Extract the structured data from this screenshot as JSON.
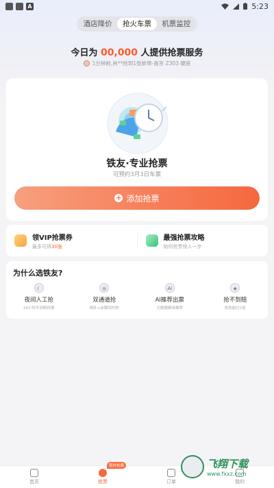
{
  "status_bar": {
    "time": "5:23",
    "left_badge": "A"
  },
  "tabs": [
    {
      "label": "酒店降价",
      "active": false
    },
    {
      "label": "抢火车票",
      "active": true
    },
    {
      "label": "机票监控",
      "active": false
    }
  ],
  "headline": {
    "prefix": "今日为",
    "count": "00,000",
    "suffix": "人提供抢票服务"
  },
  "ticker": {
    "text": "1分钟前,肖**抢到1张蚌埠-南京 Z303 硬座"
  },
  "main_card": {
    "title": "铁友·专业抢票",
    "subtitle": "可预约3月3日车票",
    "button_label": "添加抢票",
    "button_icon": "plus-circle-icon"
  },
  "promos": [
    {
      "title": "领VIP抢票券",
      "sub_prefix": "最多可得",
      "sub_highlight": "30张",
      "icon": "coupon-icon",
      "color": "#f8a23f"
    },
    {
      "title": "最强抢票攻略",
      "sub_prefix": "助你抢票快人一步",
      "sub_highlight": "",
      "icon": "guide-icon",
      "color": "#37c37a"
    }
  ],
  "why": {
    "title": "为什么选铁友?",
    "features": [
      {
        "title": "夜间人工抢",
        "sub": "24小时不间断抢票",
        "icon": "moon-icon"
      },
      {
        "title": "双通道抢",
        "sub": "候补+余票同时抢",
        "icon": "dual-channel-icon"
      },
      {
        "title": "AI推荐出票",
        "sub": "大数据精准推荐",
        "icon": "ai-icon"
      },
      {
        "title": "抢不到赔",
        "sub": "失败赔付2倍",
        "icon": "shield-icon"
      }
    ]
  },
  "bottom_nav": {
    "badge": "限时抢票",
    "items": [
      {
        "label": "首页",
        "icon": "home-icon",
        "active": false
      },
      {
        "label": "抢票",
        "icon": "ticket-icon",
        "active": true
      },
      {
        "label": "订单",
        "icon": "order-icon",
        "active": false
      },
      {
        "label": "我的",
        "icon": "user-icon",
        "active": false
      }
    ]
  },
  "watermark": {
    "text": "飞翔下载",
    "url": "www.fxxz.com"
  },
  "colors": {
    "accent": "#f6683f",
    "highlight": "#ff5a2a",
    "background": "#f4f4f6"
  }
}
